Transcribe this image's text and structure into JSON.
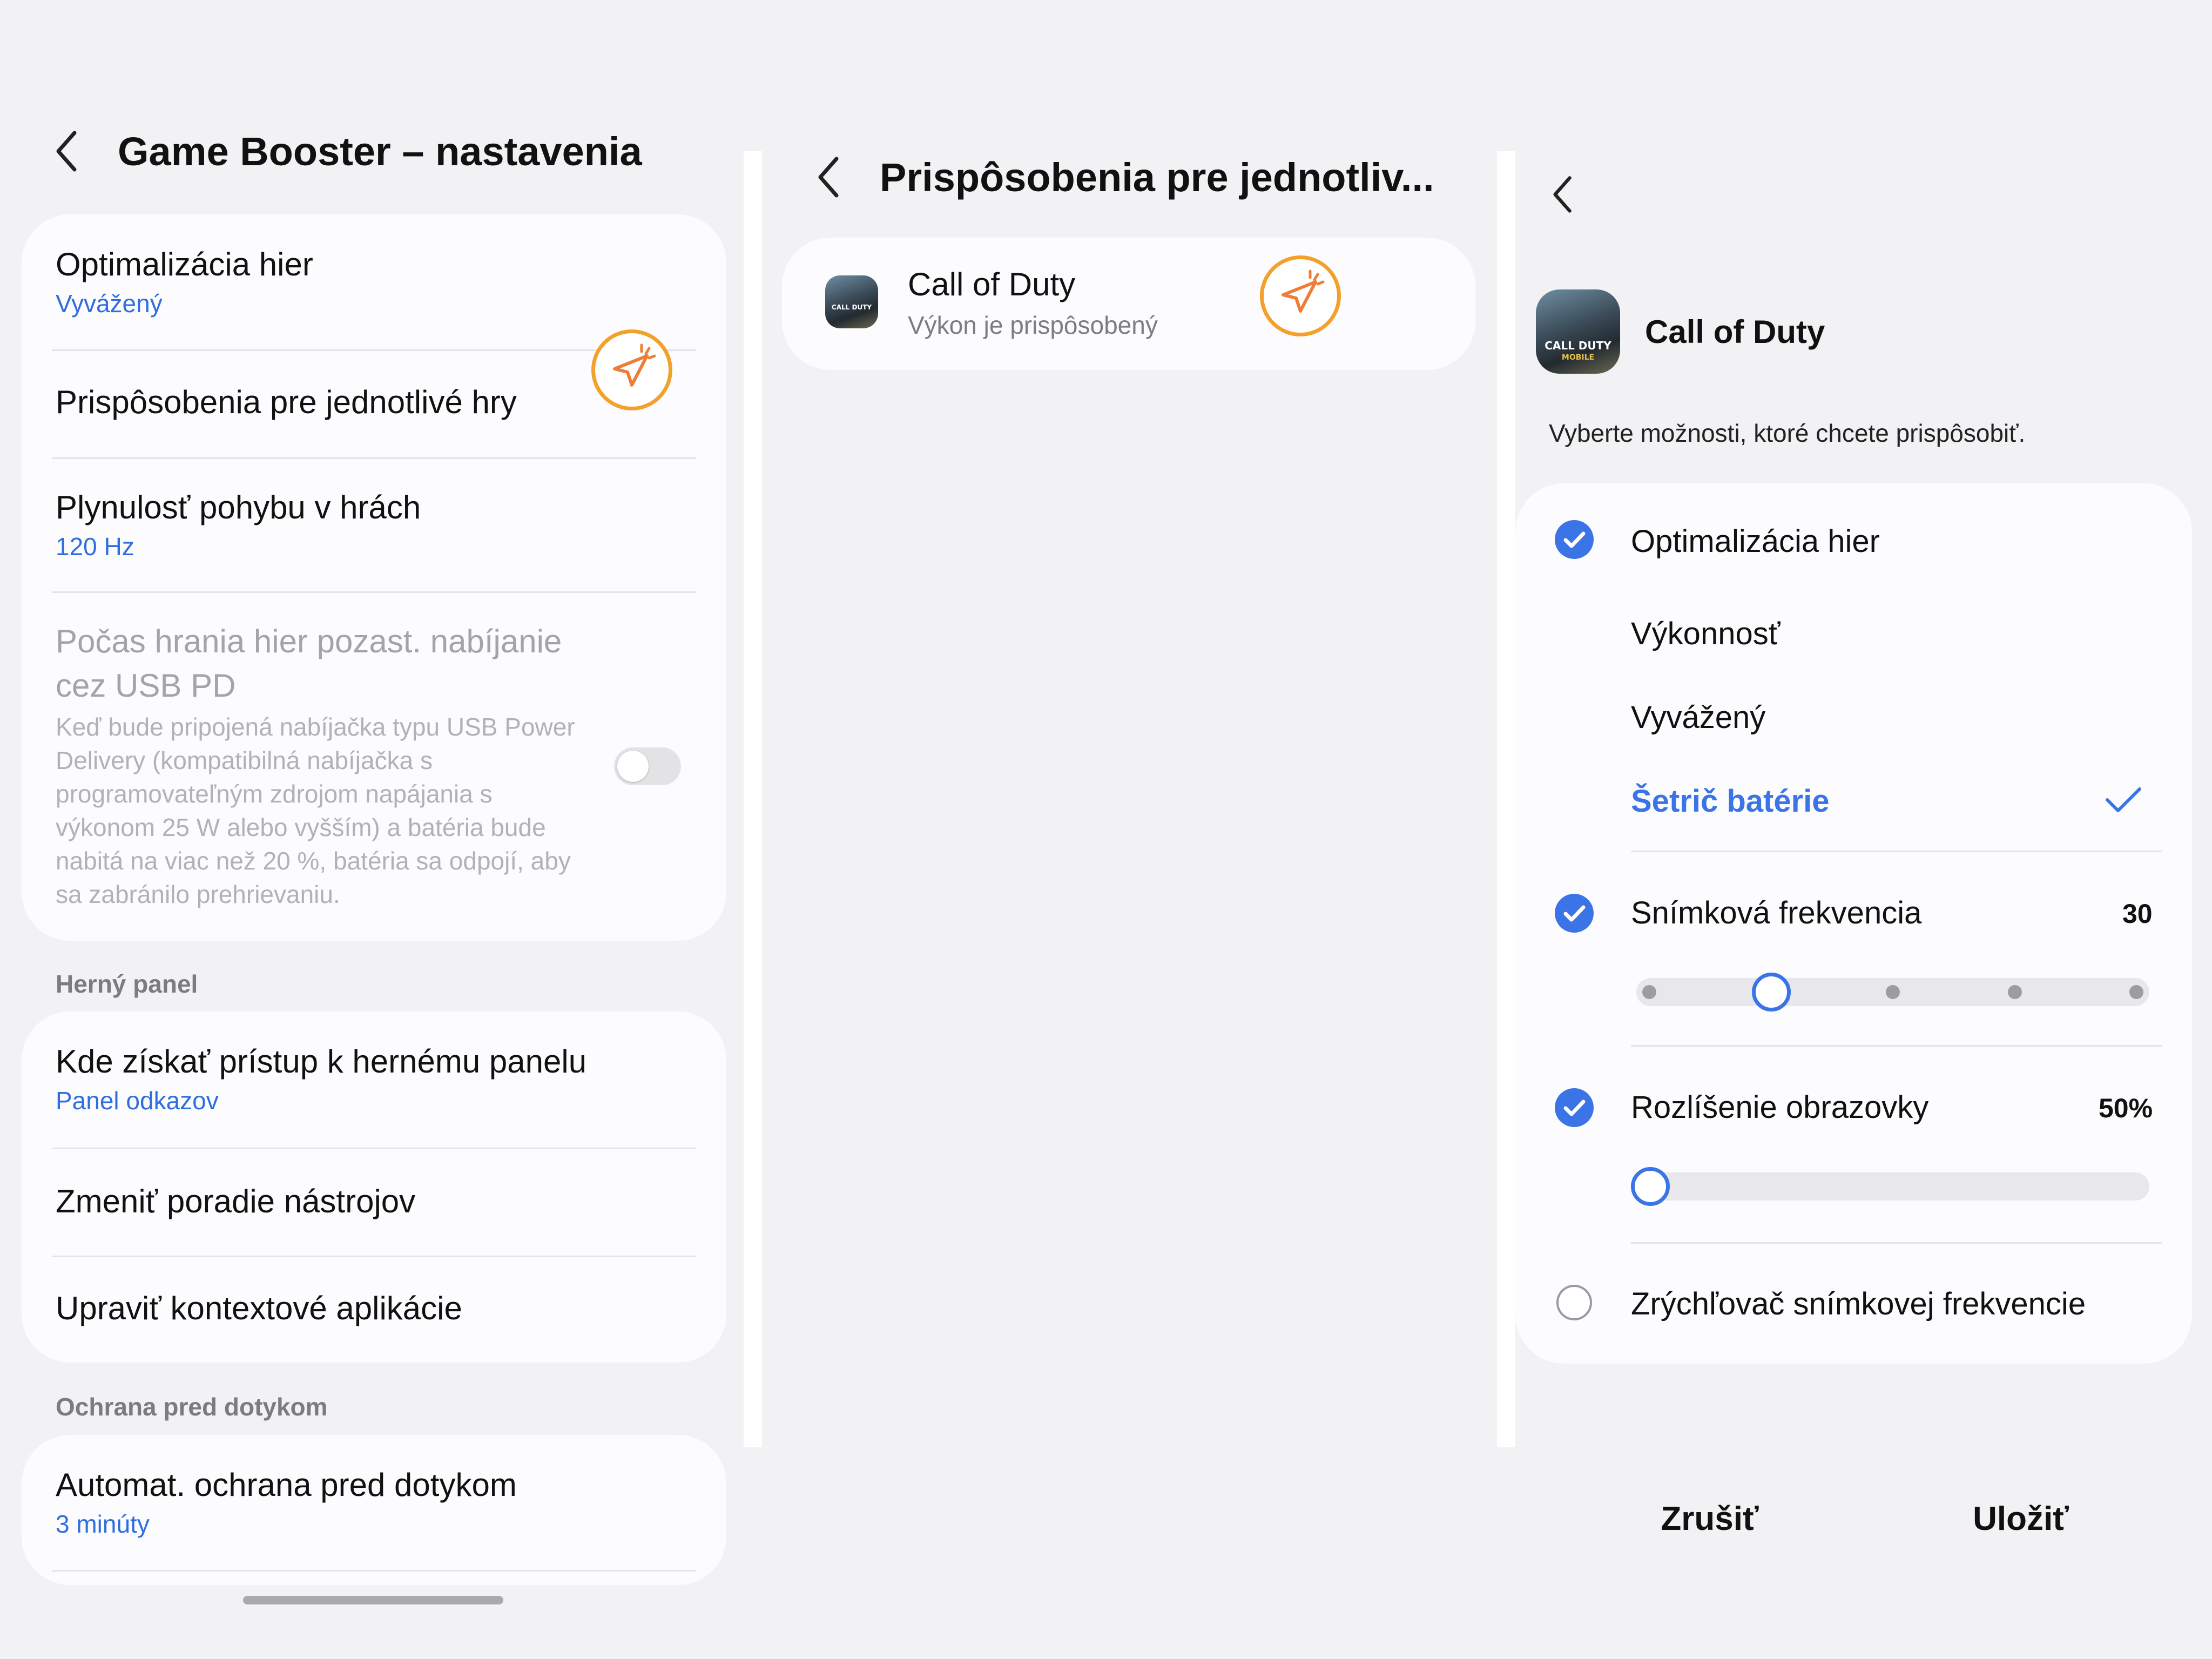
{
  "panel1": {
    "title": "Game Booster – nastavenia",
    "items": [
      {
        "title": "Optimalizácia hier",
        "subtitle": "Vyvážený"
      },
      {
        "title": "Prispôsobenia pre jednotlivé hry"
      },
      {
        "title": "Plynulosť pohybu v hrách",
        "subtitle": "120 Hz"
      },
      {
        "title_line1": "Počas hrania hier pozast. nabíjanie",
        "title_line2": "cez USB PD",
        "description": "Keď bude pripojená nabíjačka typu USB Power Delivery (kompatibilná nabíjačka s programovateľným zdrojom napájania s výkonom 25 W alebo vyšším) a batéria bude nabitá na viac než 20 %, batéria sa odpojí, aby sa zabránilo prehrievaniu.",
        "toggle_on": false
      }
    ],
    "section_game_panel": "Herný panel",
    "game_panel_items": [
      {
        "title": "Kde získať prístup k hernému panelu",
        "subtitle": "Panel odkazov"
      },
      {
        "title": "Zmeniť poradie nástrojov"
      },
      {
        "title": "Upraviť kontextové aplikácie"
      }
    ],
    "section_touch": "Ochrana pred dotykom",
    "touch_items": [
      {
        "title": "Automat. ochrana pred dotykom",
        "subtitle": "3 minúty"
      }
    ]
  },
  "panel2": {
    "title": "Prispôsobenia pre jednotliv...",
    "games": [
      {
        "name": "Call of Duty",
        "status": "Výkon je prispôsobený",
        "icon_label": "CALL DUTY"
      }
    ]
  },
  "panel3": {
    "app_name": "Call of Duty",
    "icon_label_top": "CALL DUTY",
    "icon_label_bottom": "MOBILE",
    "instruction": "Vyberte možnosti, ktoré chcete prispôsobiť.",
    "optimization": {
      "label": "Optimalizácia hier",
      "checked": true,
      "options": [
        "Výkonnosť",
        "Vyvážený",
        "Šetrič batérie"
      ],
      "selected": "Šetrič batérie"
    },
    "frame_rate": {
      "label": "Snímková frekvencia",
      "checked": true,
      "value": "30",
      "steps": 5,
      "selected_step": 2
    },
    "resolution": {
      "label": "Rozlíšenie obrazovky",
      "checked": true,
      "value": "50%",
      "level": 0
    },
    "frame_booster": {
      "label": "Zrýchľovač snímkovej frekvencie",
      "checked": false
    },
    "buttons": {
      "cancel": "Zrušiť",
      "save": "Uložiť"
    }
  },
  "colors": {
    "accent": "#3a74e6",
    "link": "#2f6ee0",
    "cursor_badge": "#f3a12a"
  },
  "icons": {
    "back": "chevron-left-icon",
    "cursor": "cursor-click-icon",
    "check": "check-icon"
  }
}
